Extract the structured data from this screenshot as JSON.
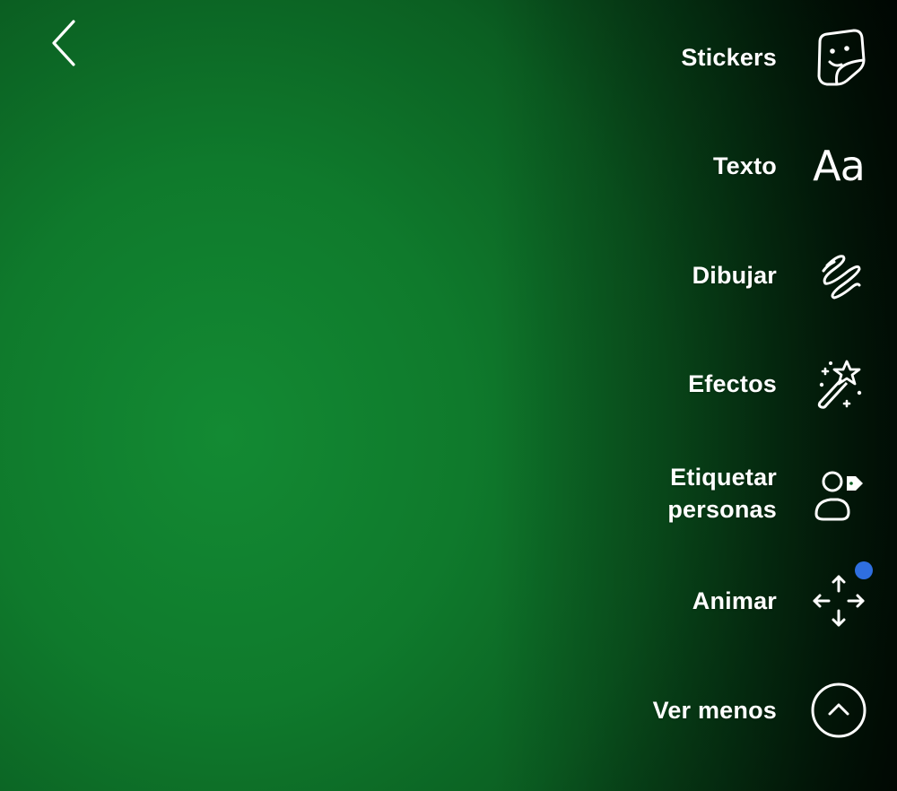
{
  "colors": {
    "background_green": "#0f7a2c",
    "text": "#ffffff",
    "notification_dot": "#2f6fe0"
  },
  "back": {
    "icon": "chevron-left-icon"
  },
  "tools": [
    {
      "label": "Stickers",
      "icon": "sticker-icon"
    },
    {
      "label": "Texto",
      "icon": "text-aa-icon",
      "icon_text": "Aa"
    },
    {
      "label": "Dibujar",
      "icon": "scribble-icon"
    },
    {
      "label": "Efectos",
      "icon": "magic-wand-icon"
    },
    {
      "label_line1": "Etiquetar",
      "label_line2": "personas",
      "icon": "tag-person-icon"
    },
    {
      "label": "Animar",
      "icon": "move-arrows-icon",
      "has_notification_dot": true
    },
    {
      "label": "Ver menos",
      "icon": "chevron-up-circle-icon"
    }
  ]
}
